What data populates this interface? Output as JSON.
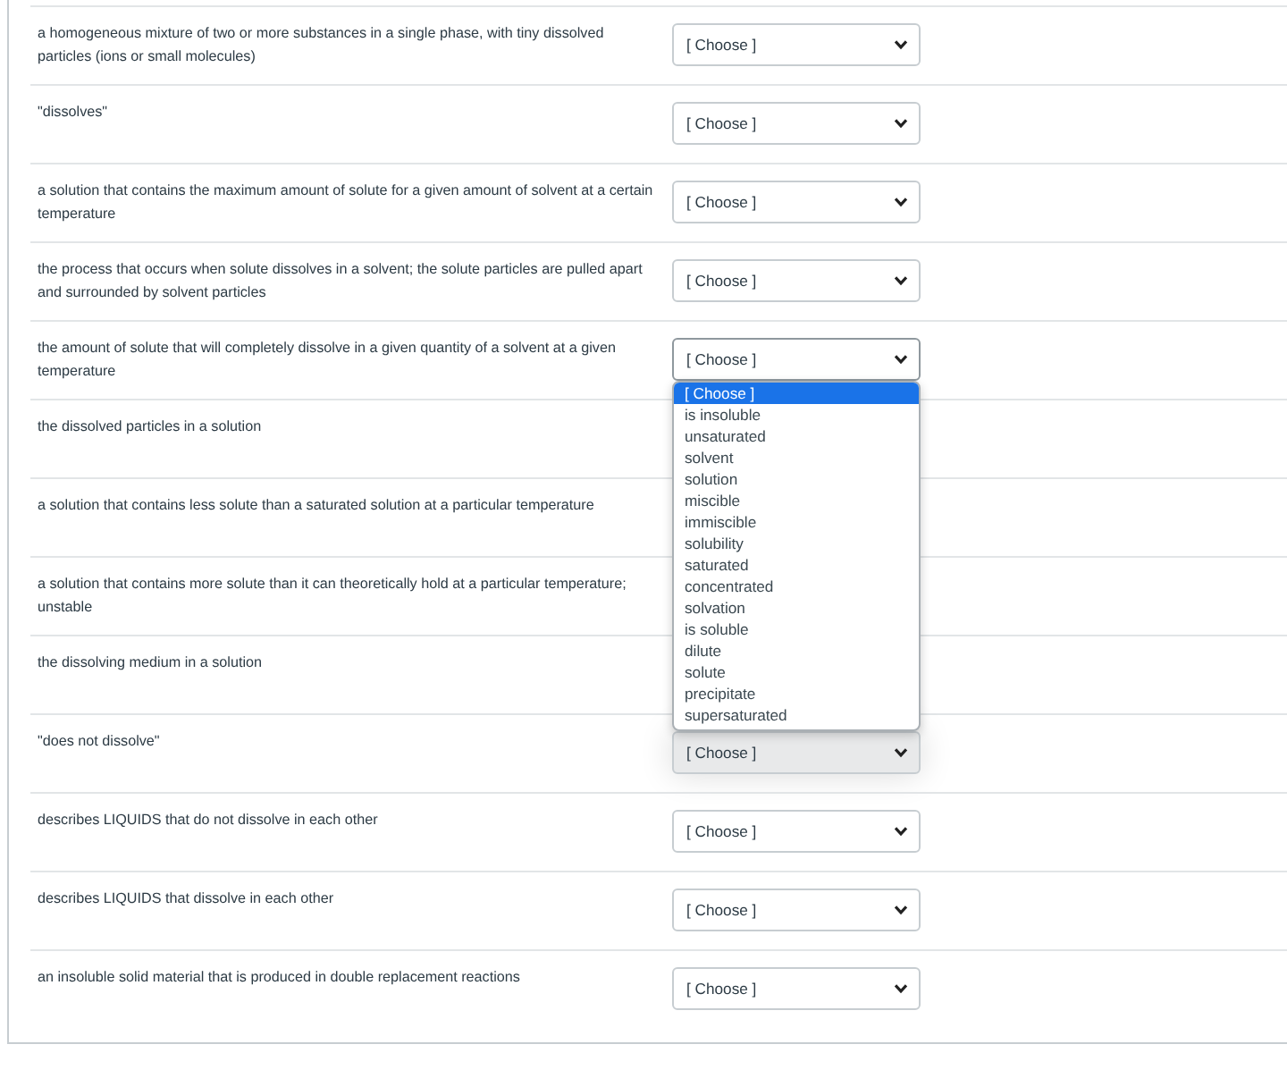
{
  "rows": [
    {
      "prompt": "a homogeneous mixture of two or more substances in a single phase, with tiny dissolved particles (ions or small molecules)",
      "answer": "[ Choose ]",
      "expanded": false,
      "highlighted": false
    },
    {
      "prompt": "\"dissolves\"",
      "answer": "[ Choose ]",
      "expanded": false,
      "highlighted": false
    },
    {
      "prompt": "a solution that contains the maximum amount of solute for a given amount of solvent at a certain temperature",
      "answer": "[ Choose ]",
      "expanded": false,
      "highlighted": false
    },
    {
      "prompt": "the process that occurs when solute dissolves in a solvent; the solute particles are pulled apart and surrounded by solvent particles",
      "answer": "[ Choose ]",
      "expanded": false,
      "highlighted": false
    },
    {
      "prompt": "the amount of solute that will completely dissolve in a given quantity of a solvent at a given temperature",
      "answer": "[ Choose ]",
      "expanded": true,
      "highlighted": false
    },
    {
      "prompt": "the dissolved particles in a solution"
    },
    {
      "prompt": "a solution that contains less solute than a saturated solution at a particular temperature"
    },
    {
      "prompt": "a solution that contains more solute than it can theoretically hold at a particular temperature; unstable"
    },
    {
      "prompt": "the dissolving medium in a solution"
    },
    {
      "prompt": "\"does not dissolve\"",
      "answer": "[ Choose ]",
      "expanded": false,
      "highlighted": true
    },
    {
      "prompt": "describes LIQUIDS that do not dissolve in each other",
      "answer": "[ Choose ]",
      "expanded": false,
      "highlighted": false
    },
    {
      "prompt": "describes LIQUIDS that dissolve in each other",
      "answer": "[ Choose ]",
      "expanded": false,
      "highlighted": false
    },
    {
      "prompt": "an insoluble solid material that is produced in double replacement reactions",
      "answer": "[ Choose ]",
      "expanded": false,
      "highlighted": false
    }
  ],
  "dropdown_options": [
    {
      "label": "[ Choose ]",
      "selected": true
    },
    {
      "label": "is insoluble",
      "selected": false
    },
    {
      "label": "unsaturated",
      "selected": false
    },
    {
      "label": "solvent",
      "selected": false
    },
    {
      "label": "solution",
      "selected": false
    },
    {
      "label": "miscible",
      "selected": false
    },
    {
      "label": "immiscible",
      "selected": false
    },
    {
      "label": "solubility",
      "selected": false
    },
    {
      "label": "saturated",
      "selected": false
    },
    {
      "label": "concentrated",
      "selected": false
    },
    {
      "label": "solvation",
      "selected": false
    },
    {
      "label": "is soluble",
      "selected": false
    },
    {
      "label": "dilute",
      "selected": false
    },
    {
      "label": "solute",
      "selected": false
    },
    {
      "label": "precipitate",
      "selected": false
    },
    {
      "label": "supersaturated",
      "selected": false
    }
  ]
}
